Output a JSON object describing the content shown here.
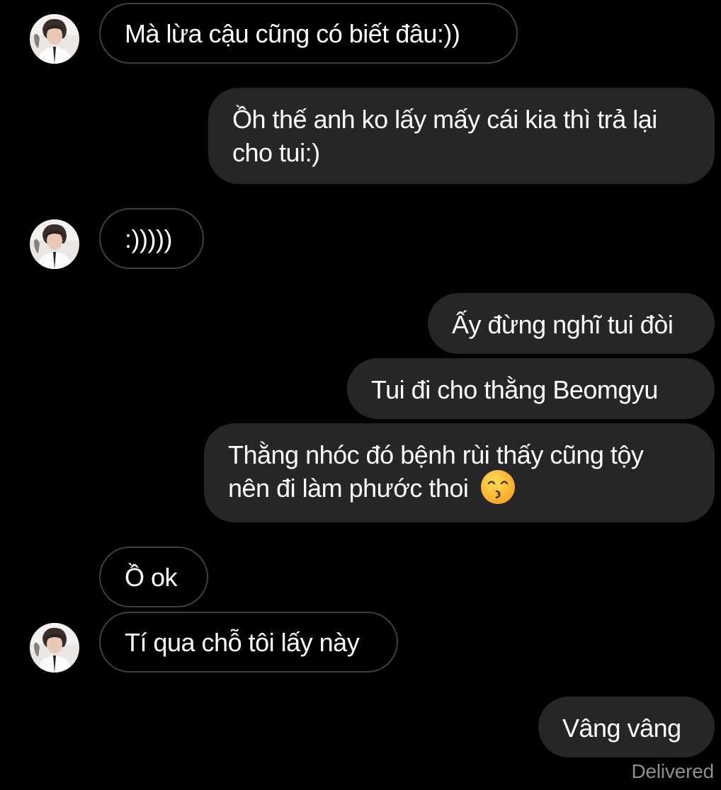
{
  "messages": [
    {
      "side": "in",
      "text": "Mà lừa cậu cũng có biết đâu:))"
    },
    {
      "side": "out",
      "line1": "Ồh thế anh ko lấy mấy cái kia thì trả lại",
      "line2": "cho tui:)"
    },
    {
      "side": "in",
      "text": ":)))))"
    },
    {
      "side": "out",
      "text": "Ấy đừng nghĩ tui đòi"
    },
    {
      "side": "out",
      "text": "Tui đi cho thằng Beomgyu"
    },
    {
      "side": "out",
      "line1": "Thằng nhóc đó bệnh rùi thấy cũng tộy",
      "line2": "nên đi làm phước thoi",
      "emoji": "kissing-smiling-eyes-emoji"
    },
    {
      "side": "in",
      "text": "Ồ ok"
    },
    {
      "side": "in",
      "text": "Tí qua chỗ tôi lấy này"
    },
    {
      "side": "out",
      "text": "Vâng vâng"
    }
  ],
  "status": "Delivered",
  "colors": {
    "background": "#000000",
    "outgoing_bubble": "#262629",
    "incoming_border": "#3f3f41",
    "text": "#ffffff",
    "status_text": "#8e8e93"
  }
}
